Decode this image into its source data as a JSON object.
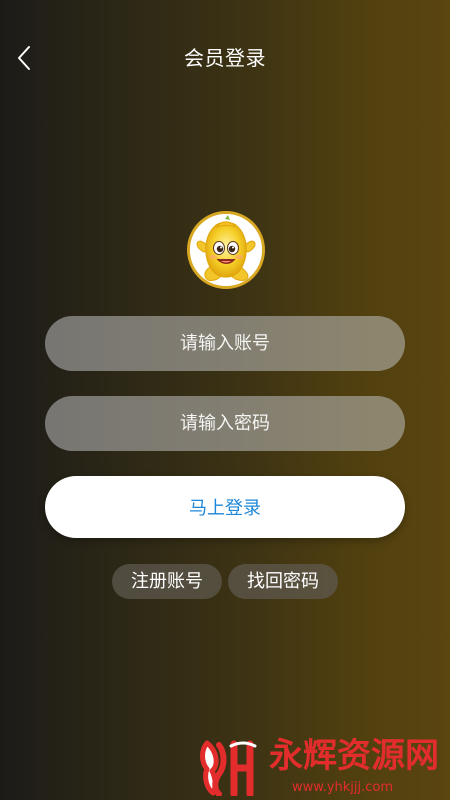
{
  "navigation": {
    "back_icon": "chevron-left-icon",
    "title": "会员登录"
  },
  "profile": {
    "avatar_icon": "yellow-mascot-avatar-icon",
    "avatar_border_color": "#D9A823"
  },
  "form": {
    "account_placeholder": "请输入账号",
    "password_placeholder": "请输入密码",
    "account_value": "",
    "password_value": ""
  },
  "actions": {
    "login_label": "马上登录",
    "register_label": "注册账号",
    "recover_password_label": "找回密码"
  },
  "watermark": {
    "title": "永辉资源网",
    "url": "www.yhkjjj.com",
    "color": "#E32D2D"
  },
  "colors": {
    "login_text": "#1D87D8",
    "background_dark": "#1C1B18",
    "background_gold": "#5A4510"
  }
}
